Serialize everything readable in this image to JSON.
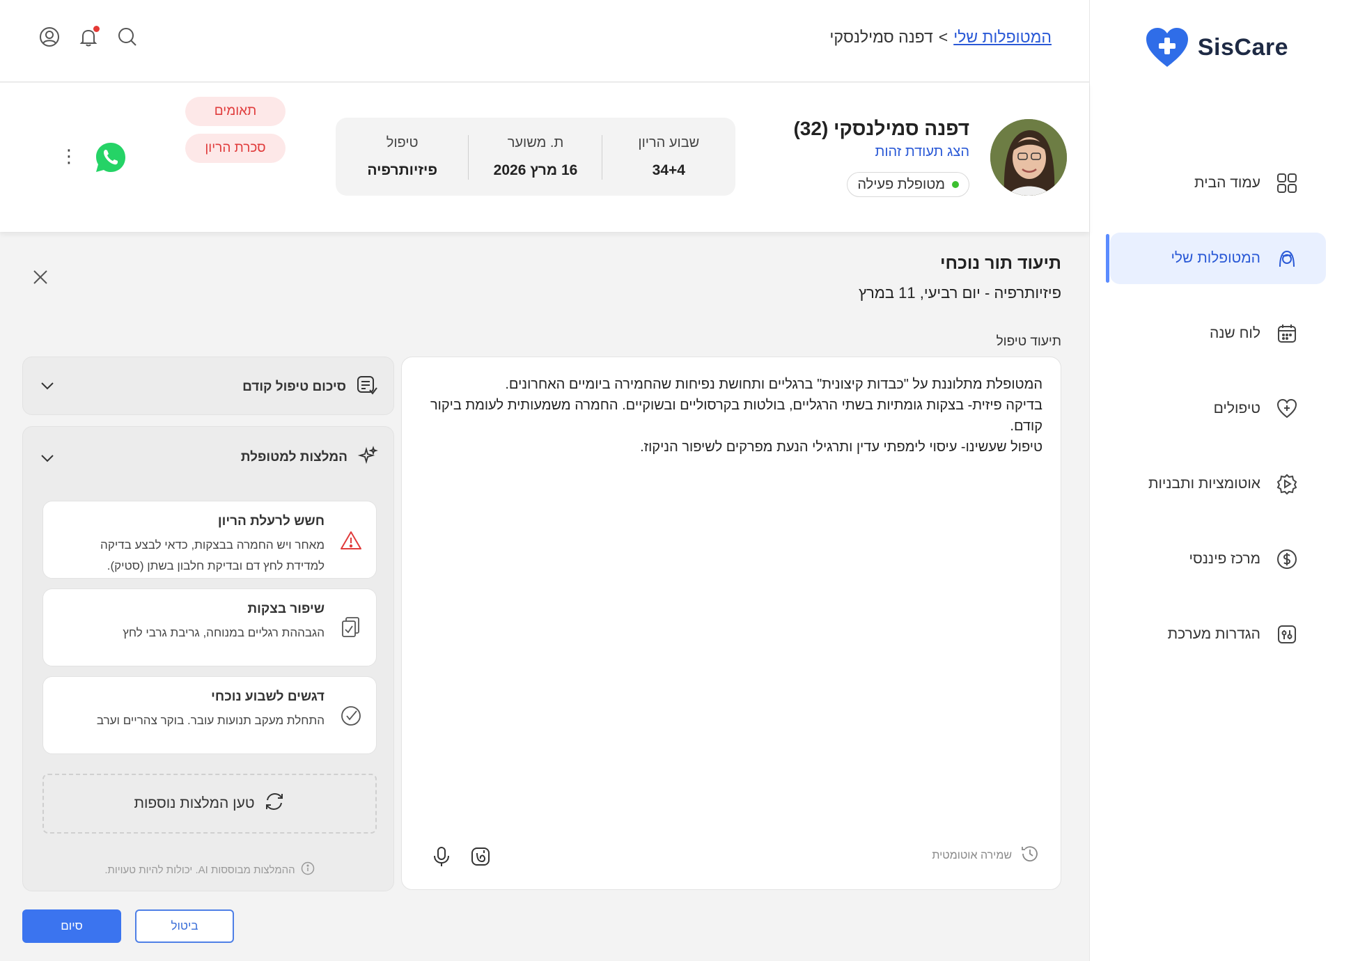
{
  "app": {
    "brand": "SisCare",
    "brand_color": "#2f6de8"
  },
  "sidebar": {
    "items": [
      {
        "label": "עמוד הבית",
        "icon": "grid-icon",
        "active": false
      },
      {
        "label": "המטופלות שלי",
        "icon": "patient-face-icon",
        "active": true
      },
      {
        "label": "לוח שנה",
        "icon": "calendar-icon",
        "active": false
      },
      {
        "label": "טיפולים",
        "icon": "heart-plus-icon",
        "active": false
      },
      {
        "label": "אוטומציות ותבניות",
        "icon": "automation-gear-icon",
        "active": false
      },
      {
        "label": "מרכז פיננסי",
        "icon": "dollar-circle-icon",
        "active": false
      },
      {
        "label": "הגדרות מערכת",
        "icon": "settings-sliders-icon",
        "active": false
      }
    ]
  },
  "breadcrumb": {
    "parent": "המטופלות שלי",
    "separator": ">",
    "current": "דפנה סמילנסקי"
  },
  "patient": {
    "name": "דפנה סמילנסקי (32)",
    "id_link": "הצג תעודת זהות",
    "status": "מטופלת פעילה",
    "stats": [
      {
        "label": "שבוע הריון",
        "value": "34+4"
      },
      {
        "label": "ת. משוער",
        "value": "16 מרץ 2026"
      },
      {
        "label": "טיפול",
        "value": "פיזיותרפיה"
      }
    ],
    "tags": [
      "תאומים",
      "סכרת הריון"
    ]
  },
  "session": {
    "title": "תיעוד תור נוכחי",
    "subtitle": "פיזיותרפיה  -  יום רביעי, 11 במרץ",
    "notes_label": "תיעוד טיפול",
    "notes_lines": [
      "המטופלת מתלוננת על \"כבדות קיצונית\" ברגליים ותחושת נפיחות שהחמירה ביומיים האחרונים.",
      "בדיקה פיזית- בצקות גומתיות בשתי הרגליים, בולטות בקרסוליים ובשוקיים. החמרה משמעותית לעומת ביקור קודם.",
      "טיפול שעשינו- עיסוי לימפתי עדין ותרגילי הנעת מפרקים לשיפור הניקוז."
    ],
    "autosave": "שמירה אוטומטית"
  },
  "panels": {
    "previous_summary": "סיכום טיפול קודם",
    "recommendations_title": "המלצות למטופלת",
    "recommendations": [
      {
        "title": "חשש לרעלת הריון",
        "text": "מאחר ויש החמרה בבצקות, כדאי לבצע בדיקה למדידת לחץ דם ובדיקת חלבון בשתן (סטיק).",
        "icon": "warning-triangle-icon"
      },
      {
        "title": "שיפור בצקות",
        "text": "הגבההת רגליים במנוחה, גריבת גרבי לחץ",
        "icon": "clipboard-check-icon"
      },
      {
        "title": "דגשים לשבוע נוכחי",
        "text": "התחלת מעקב תנועות עובר. בוקר צהריים וערב",
        "icon": "check-circle-icon"
      }
    ],
    "load_more": "טען המלצות נוספות",
    "ai_disclaimer": "ההמלצות מבוססות AI. יכולות להיות טעויות."
  },
  "actions": {
    "finish": "סיום",
    "cancel": "ביטול"
  }
}
